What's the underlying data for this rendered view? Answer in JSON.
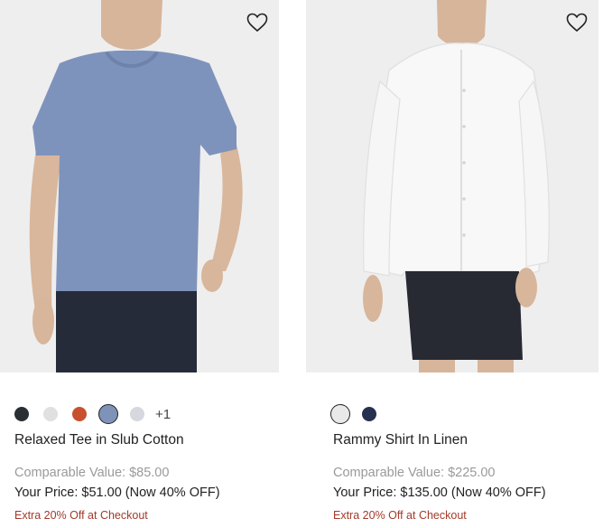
{
  "products": [
    {
      "title": "Relaxed Tee in Slub Cotton",
      "comparable_label": "Comparable Value: $85.00",
      "price_label": "Your Price: $51.00 (Now 40% OFF)",
      "promo_label": "Extra 20% Off at Checkout",
      "more_colors": "+1",
      "swatches": [
        "#2a2f33",
        "#e0e0e0",
        "#c8502f",
        "#7f93b9",
        "#d6d8df"
      ],
      "selected_swatch": 3
    },
    {
      "title": "Rammy Shirt In Linen",
      "comparable_label": "Comparable Value: $225.00",
      "price_label": "Your Price: $135.00 (Now 40% OFF)",
      "promo_label": "Extra 20% Off at Checkout",
      "swatches": [
        "#e9e9e9",
        "#27304f"
      ],
      "selected_swatch": 0
    }
  ],
  "icons": {
    "wishlist": "heart-outline-icon"
  }
}
